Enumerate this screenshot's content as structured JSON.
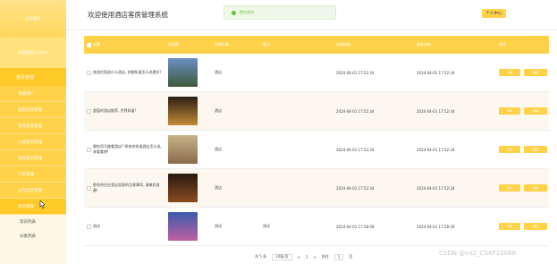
{
  "sidebar": {
    "logo_text": "后台管理",
    "user_text": "欢迎管理员 admin",
    "home_label": "首页管理",
    "menu": [
      {
        "label": "系统用户"
      },
      {
        "label": "酒店信息管理"
      },
      {
        "label": "客房信息管理"
      },
      {
        "label": "入住登记管理"
      },
      {
        "label": "退房登记管理"
      },
      {
        "label": "订单管理"
      },
      {
        "label": "公告信息管理"
      },
      {
        "label": "资讯管理"
      }
    ],
    "submenu": [
      {
        "label": "资讯列表"
      },
      {
        "label": "分类列表"
      }
    ]
  },
  "header": {
    "title": "欢迎使用酒店客房管理系统",
    "toast": "提交成功",
    "profile_button": "个人中心"
  },
  "table": {
    "columns": {
      "title": "标题",
      "image": "封面图",
      "category": "所属分类",
      "note": "备注",
      "created": "创建时间",
      "updated": "更新时间",
      "ops": "操作"
    },
    "detail_label": "详情",
    "delete_label": "删除",
    "rows": [
      {
        "title": "旅游住宿选什么酒店, 你都知道怎么选更好?",
        "category": "酒店",
        "note": "",
        "created": "2024-04-01 17:52:34",
        "updated": "2024-04-01 17:52:34",
        "thumb_top": "#6b8fc4",
        "thumb_bottom": "#3d5a3a"
      },
      {
        "title": "超值的酒店推荐, 世界知道!",
        "category": "酒店",
        "note": "",
        "created": "2024-04-01 17:52:34",
        "updated": "2024-04-01 17:52:34",
        "thumb_top": "#2a1f14",
        "thumb_bottom": "#c48a3a"
      },
      {
        "title": "跟你用马路看酒店? 原来你知道酒店怎么选, 来看看吧!",
        "category": "酒店",
        "note": "",
        "created": "2024-04-01 17:52:34",
        "updated": "2024-04-01 17:52:34",
        "thumb_top": "#c7b48a",
        "thumb_bottom": "#8a6a4a"
      },
      {
        "title": "那些你住在酒店里面的注意事项, 请做好准备!",
        "category": "酒店",
        "note": "",
        "created": "2024-04-01 17:52:34",
        "updated": "2024-04-01 17:52:34",
        "thumb_top": "#2a1a10",
        "thumb_bottom": "#8a4a20"
      },
      {
        "title": "测试",
        "category": "测试",
        "note": "测试",
        "created": "2024-04-01 17:58:39",
        "updated": "2024-04-01 17:58:39",
        "thumb_top": "#3a5ab0",
        "thumb_bottom": "#c060a0"
      }
    ]
  },
  "pagination": {
    "total": "共 5 条",
    "page_size": "10条/页",
    "prev": "<",
    "page": "1",
    "next": ">",
    "goto_label": "前往",
    "goto_value": "1",
    "page_suffix": "页"
  },
  "watermark": "CSDN @vx2_CXKF10088",
  "colors": {
    "accent": "#ffd24a",
    "sidebar_active": "#ffc928",
    "toast_green": "#67c23a"
  }
}
